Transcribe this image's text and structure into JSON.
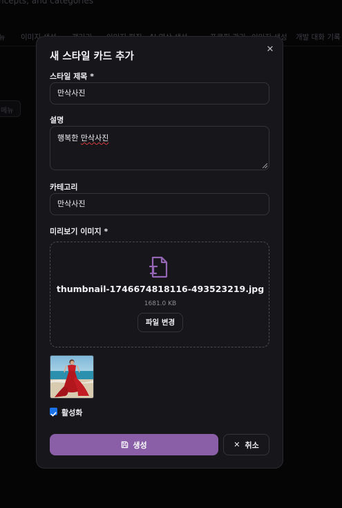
{
  "background": {
    "top_text": "ncepts, and categories",
    "tabs": [
      "뉴",
      "이미지 생성",
      "갤러리",
      "이미지 편집",
      "AI 영상 생성",
      "프로필 관리",
      "이미지 생성",
      "개발 대화 기록"
    ],
    "menu_label": "메뉴"
  },
  "modal": {
    "title": "새 스타일 카드 추가",
    "close_icon": "close-icon",
    "title_field": {
      "label": "스타일 제목 *",
      "value": "만삭사진"
    },
    "description_field": {
      "label": "설명",
      "value_prefix": "행복한 ",
      "value_misspelled": "만삭사진"
    },
    "category_field": {
      "label": "카테고리",
      "value": "만삭사진"
    },
    "preview": {
      "label": "미리보기 이미지 *",
      "icon": "file-type-icon",
      "file_name": "thumbnail-1746674818116-493523219.jpg",
      "file_size": "1681.0 KB",
      "change_label": "파일 변경"
    },
    "active_checkbox": {
      "label": "활성화",
      "checked": true
    },
    "create_button": {
      "label": "생성",
      "icon": "save-icon"
    },
    "cancel_button": {
      "label": "취소",
      "icon": "close-icon"
    }
  },
  "colors": {
    "accent": "#8b5fa8",
    "checkbox": "#1a73e8",
    "modal_bg": "#17171b",
    "page_bg": "#050506"
  }
}
